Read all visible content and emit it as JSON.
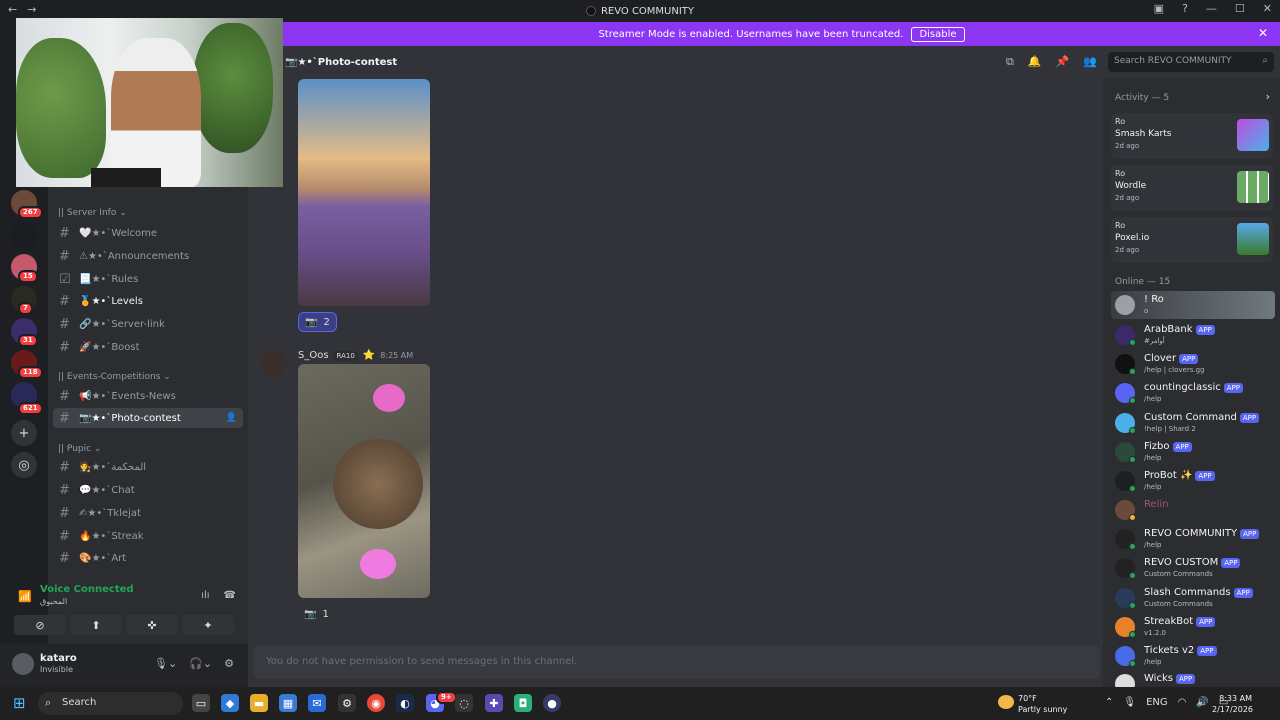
{
  "window": {
    "title": "REVO COMMUNITY"
  },
  "banner": {
    "text": "Streamer Mode is enabled. Usernames have been truncated.",
    "button": "Disable"
  },
  "servers": {
    "badges": [
      "267",
      "15",
      "7",
      "31",
      "118",
      "621"
    ]
  },
  "sidebar": {
    "categories": [
      "|| Server Info",
      "|| Events-Competitions",
      "|| Pupic"
    ],
    "channels": [
      {
        "label": "🤍★•`Welcome"
      },
      {
        "label": "⚠★•`Announcements"
      },
      {
        "label": "📃★•`Rules"
      },
      {
        "label": "🏅★•`Levels"
      },
      {
        "label": "🔗★•`Server-link"
      },
      {
        "label": "🚀★•`Boost"
      },
      {
        "label": "📢★•`Events-News"
      },
      {
        "label": "📷★•`Photo-contest"
      },
      {
        "label": "🧑‍⚖★•`المحكمة"
      },
      {
        "label": "💬★•`Chat"
      },
      {
        "label": "✍★•`Tklejat"
      },
      {
        "label": "🔥★•`Streak"
      },
      {
        "label": "🎨★•`Art"
      }
    ]
  },
  "voice": {
    "status": "Voice Connected",
    "channel": "المحبوق"
  },
  "user": {
    "name": "kataro",
    "status": "Invisible"
  },
  "chat": {
    "channel_title": "📷★•`Photo-contest",
    "search_placeholder": "Search REVO COMMUNITY",
    "message": {
      "author": "S_Oos",
      "tag": "RA10",
      "time": "8:25 AM"
    },
    "reactions": [
      "2",
      "1"
    ],
    "composer_placeholder": "You do not have permission to send messages in this channel."
  },
  "members": {
    "activity_title": "Activity — 5",
    "activities": [
      {
        "name": "Ro",
        "game": "Smash Karts",
        "time": "2d ago"
      },
      {
        "name": "Ro",
        "game": "Wordle",
        "time": "2d ago"
      },
      {
        "name": "Ro",
        "game": "Poxel.io",
        "time": "2d ago"
      }
    ],
    "online_title": "Online — 15",
    "list": [
      {
        "name": "! Ro",
        "sub": "o",
        "app": ""
      },
      {
        "name": "ArabBank",
        "sub": "#أوامر",
        "app": "APP"
      },
      {
        "name": "Clover",
        "sub": "/help | clovers.gg",
        "app": "APP"
      },
      {
        "name": "countingclassic",
        "sub": "/help",
        "app": "APP"
      },
      {
        "name": "Custom Command",
        "sub": "!help | Shard 2",
        "app": "APP"
      },
      {
        "name": "Fizbo",
        "sub": "/help",
        "app": "APP"
      },
      {
        "name": "ProBot ✨",
        "sub": "/help",
        "app": "APP"
      },
      {
        "name": "Relin",
        "sub": "",
        "app": ""
      },
      {
        "name": "REVO COMMUNITY",
        "sub": "/help",
        "app": "APP"
      },
      {
        "name": "REVO CUSTOM",
        "sub": "Custom Commands",
        "app": "APP"
      },
      {
        "name": "Slash Commands",
        "sub": "Custom Commands",
        "app": "APP"
      },
      {
        "name": "StreakBot",
        "sub": "v1.2.0",
        "app": "APP"
      },
      {
        "name": "Tickets v2",
        "sub": "/help",
        "app": "APP"
      },
      {
        "name": "Wicks",
        "sub": "",
        "app": "APP"
      }
    ]
  },
  "taskbar": {
    "search": "Search",
    "weather_temp": "70°F",
    "weather_desc": "Partly sunny",
    "lang": "ENG",
    "time": "8:33 AM",
    "date": "2/17/2026",
    "notif_badge": "9+"
  }
}
